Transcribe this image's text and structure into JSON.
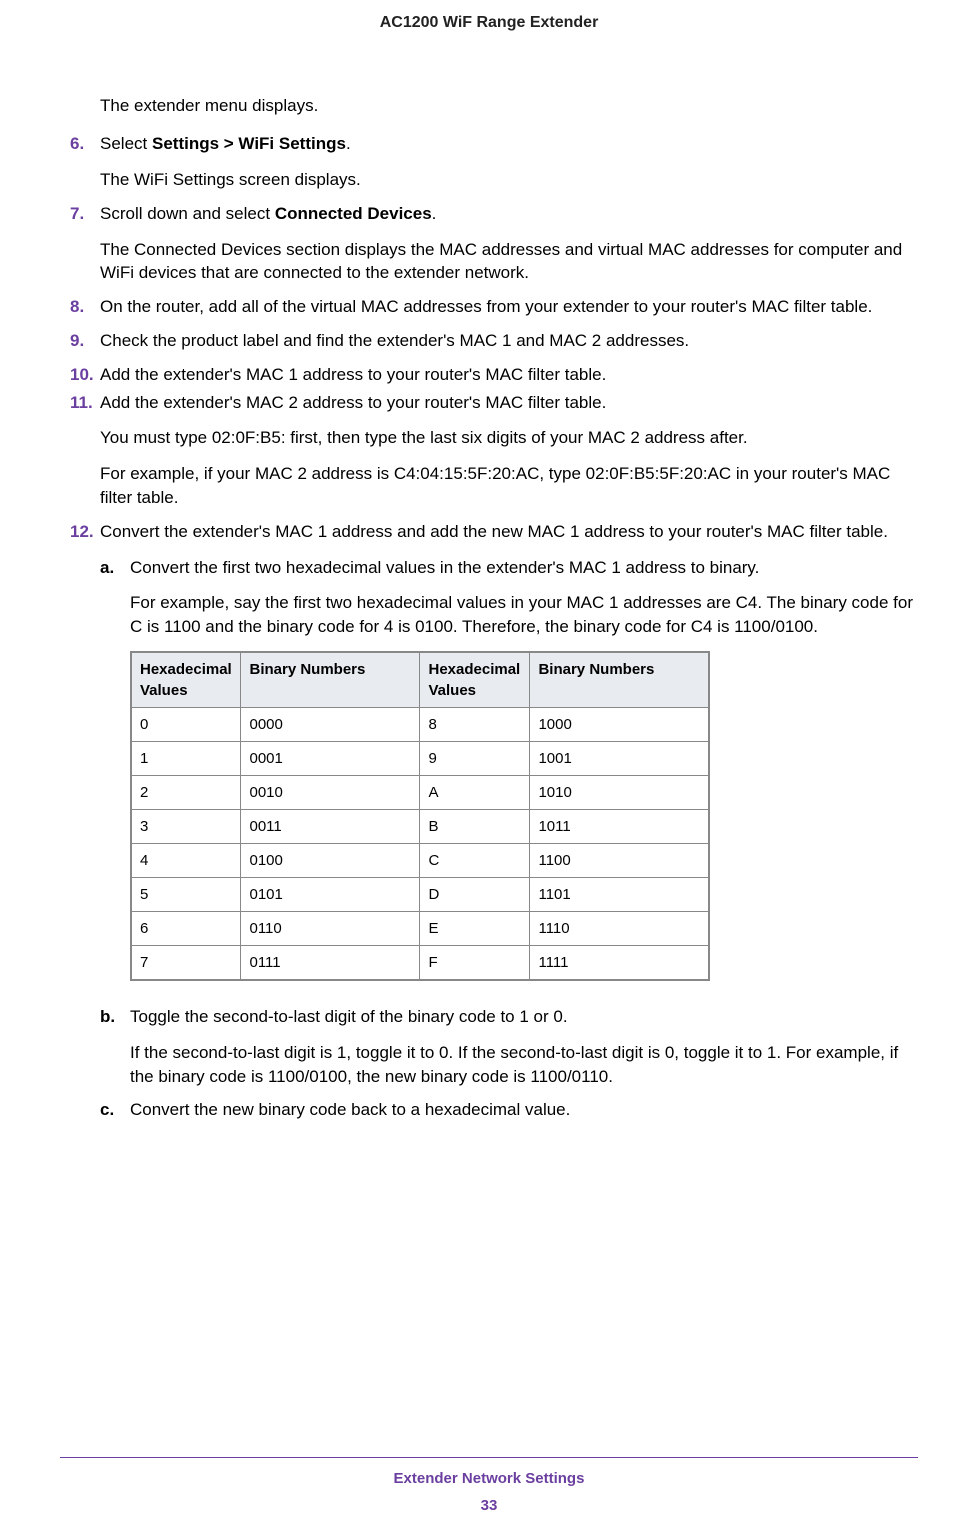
{
  "header": {
    "title": "AC1200 WiF Range Extender"
  },
  "intro": "The extender menu displays.",
  "steps": {
    "s6": {
      "num": "6.",
      "pre": "Select ",
      "bold": "Settings > WiFi Settings",
      "post": ".",
      "after": "The WiFi Settings screen displays."
    },
    "s7": {
      "num": "7.",
      "pre": "Scroll down and select ",
      "bold": "Connected Devices",
      "post": ".",
      "after": "The Connected Devices section displays the MAC addresses and virtual MAC addresses for computer and WiFi devices that are connected to the extender network."
    },
    "s8": {
      "num": "8.",
      "text": "On the router, add all of the virtual MAC addresses from your extender to your router's MAC filter table."
    },
    "s9": {
      "num": "9.",
      "text": "Check the product label and find the extender's MAC 1 and MAC 2 addresses."
    },
    "s10": {
      "num": "10.",
      "text": "Add the extender's MAC 1 address to your router's MAC filter table."
    },
    "s11": {
      "num": "11.",
      "text": "Add the extender's MAC 2 address to your router's MAC filter table.",
      "after1": "You must type 02:0F:B5: first, then type the last six digits of your MAC 2 address after.",
      "after2": "For example, if your MAC 2 address is C4:04:15:5F:20:AC, type 02:0F:B5:5F:20:AC in your router's MAC filter table."
    },
    "s12": {
      "num": "12.",
      "text": "Convert the extender's MAC 1 address and add the new MAC 1 address to your router's MAC filter table.",
      "a": {
        "letter": "a.",
        "text": "Convert the first two hexadecimal values in the extender's MAC 1 address to binary.",
        "after": "For example, say the first two hexadecimal values in your MAC 1 addresses are C4. The binary code for C is 1100 and the binary code for 4 is 0100. Therefore, the binary code for C4 is 1100/0100."
      },
      "b": {
        "letter": "b.",
        "text": "Toggle the second-to-last digit of the binary code to 1 or 0.",
        "after": "If the second-to-last digit is 1, toggle it to 0. If the second-to-last digit is 0, toggle it to 1. For example, if the binary code is 1100/0100, the new binary code is 1100/0110."
      },
      "c": {
        "letter": "c.",
        "text": "Convert the new binary code back to a hexadecimal value."
      }
    }
  },
  "table": {
    "headers": {
      "h1": "Hexadecimal Values",
      "h2": "Binary Numbers",
      "h3": "Hexadecimal Values",
      "h4": "Binary Numbers"
    },
    "rows": [
      {
        "c1": "0",
        "c2": "0000",
        "c3": "8",
        "c4": "1000"
      },
      {
        "c1": "1",
        "c2": "0001",
        "c3": "9",
        "c4": "1001"
      },
      {
        "c1": "2",
        "c2": "0010",
        "c3": "A",
        "c4": "1010"
      },
      {
        "c1": "3",
        "c2": "0011",
        "c3": "B",
        "c4": "1011"
      },
      {
        "c1": "4",
        "c2": "0100",
        "c3": "C",
        "c4": "1100"
      },
      {
        "c1": "5",
        "c2": "0101",
        "c3": "D",
        "c4": "1101"
      },
      {
        "c1": "6",
        "c2": "0110",
        "c3": "E",
        "c4": "1110"
      },
      {
        "c1": "7",
        "c2": "0111",
        "c3": "F",
        "c4": "1111"
      }
    ]
  },
  "footer": {
    "title": "Extender Network Settings",
    "page": "33"
  }
}
